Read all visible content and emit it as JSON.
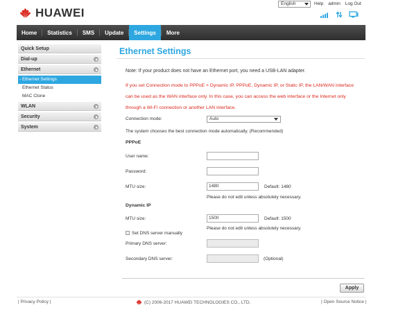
{
  "header": {
    "brand": "HUAWEI",
    "language": "English",
    "links": [
      "Help",
      "admin",
      "Log Out"
    ],
    "accent": "#2ea7e0",
    "icons": [
      "signal-icon",
      "data-transfer-icon",
      "pc-connection-icon"
    ]
  },
  "nav": {
    "items": [
      "Home",
      "Statistics",
      "SMS",
      "Update",
      "Settings",
      "More"
    ],
    "active": "Settings"
  },
  "sidebar": {
    "quick_setup": "Quick Setup",
    "dialup": "Dial-up",
    "ethernet": "Ethernet",
    "ethernet_settings": "- Ethernet Settings",
    "ethernet_status": "Ethernet Status",
    "mac_clone": "MAC Clone",
    "wlan": "WLAN",
    "security": "Security",
    "system": "System"
  },
  "main": {
    "title": "Ethernet Settings",
    "note": "Note: If your product does not have an Ethernet port, you need a USB-LAN adapter.",
    "warning": "If you set Connection mode to PPPoE + Dynamic IP, PPPoE, Dynamic IP, or Static IP, the LAN/WAN interface can be used as the WAN interface only. In this case, you can access the web interface or the Internet only through a Wi-Fi connection or another LAN interface.",
    "connection_mode_label": "Connection mode:",
    "connection_mode_value": "Auto",
    "auto_hint": "The system chooses the best connection mode automatically. (Recommended)",
    "pppoe": {
      "title": "PPPoE",
      "username_label": "User name:",
      "username_value": "",
      "password_label": "Password:",
      "password_value": "",
      "mtu_label": "MTU size:",
      "mtu_value": "1480",
      "mtu_default": "Default: 1480",
      "mtu_note": "Please do not edit unless absolutely necessary."
    },
    "dynamic_ip": {
      "title": "Dynamic IP",
      "mtu_label": "MTU size:",
      "mtu_value": "1500",
      "mtu_default": "Default: 1500",
      "mtu_note": "Please do not edit unless absolutely necessary.",
      "dns_checkbox_label": "Set DNS server manually",
      "dns_checked": false,
      "primary_dns_label": "Primary DNS server:",
      "secondary_dns_label": "Secondary DNS server:",
      "optional": "(Optional)"
    },
    "apply": "Apply"
  },
  "footer": {
    "privacy": "| Privacy Policy |",
    "copyright": "(C) 2006-2017 HUAWEI TECHNOLOGIES CO., LTD.",
    "open_source": "| Open Source Notice |"
  }
}
